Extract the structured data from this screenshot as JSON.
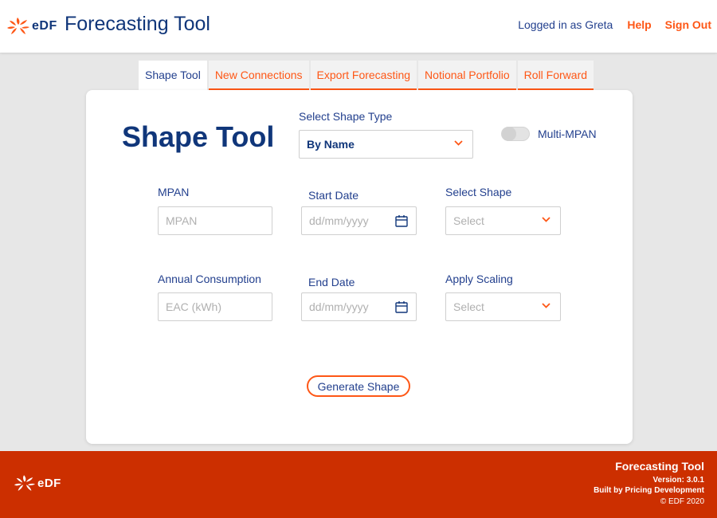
{
  "header": {
    "logo_text": "eDF",
    "app_title": "Forecasting Tool",
    "logged_in_text": "Logged in as Greta",
    "help_label": "Help",
    "sign_out_label": "Sign Out"
  },
  "tabs": [
    {
      "label": "Shape Tool",
      "active": true
    },
    {
      "label": "New Connections",
      "active": false
    },
    {
      "label": "Export Forecasting",
      "active": false
    },
    {
      "label": "Notional Portfolio",
      "active": false
    },
    {
      "label": "Roll Forward",
      "active": false
    }
  ],
  "form": {
    "title": "Shape Tool",
    "shape_type": {
      "label": "Select Shape Type",
      "value": "By Name"
    },
    "multi_mpan": {
      "label": "Multi-MPAN",
      "enabled": false
    },
    "mpan": {
      "label": "MPAN",
      "placeholder": "MPAN"
    },
    "start_date": {
      "label": "Start Date",
      "placeholder": "dd/mm/yyyy"
    },
    "select_shape": {
      "label": "Select Shape",
      "placeholder": "Select"
    },
    "annual_consumption": {
      "label": "Annual Consumption",
      "placeholder": "EAC (kWh)"
    },
    "end_date": {
      "label": "End Date",
      "placeholder": "dd/mm/yyyy"
    },
    "apply_scaling": {
      "label": "Apply Scaling",
      "placeholder": "Select"
    },
    "generate_label": "Generate Shape"
  },
  "footer": {
    "logo_text": "eDF",
    "title": "Forecasting Tool",
    "version": "Version: 3.0.1",
    "built_by": "Built by Pricing Development",
    "copyright": "© EDF 2020"
  },
  "colors": {
    "brand_orange": "#fe5716",
    "brand_navy": "#10367a",
    "footer_red": "#cc2f00",
    "background": "#e7e7e7"
  }
}
